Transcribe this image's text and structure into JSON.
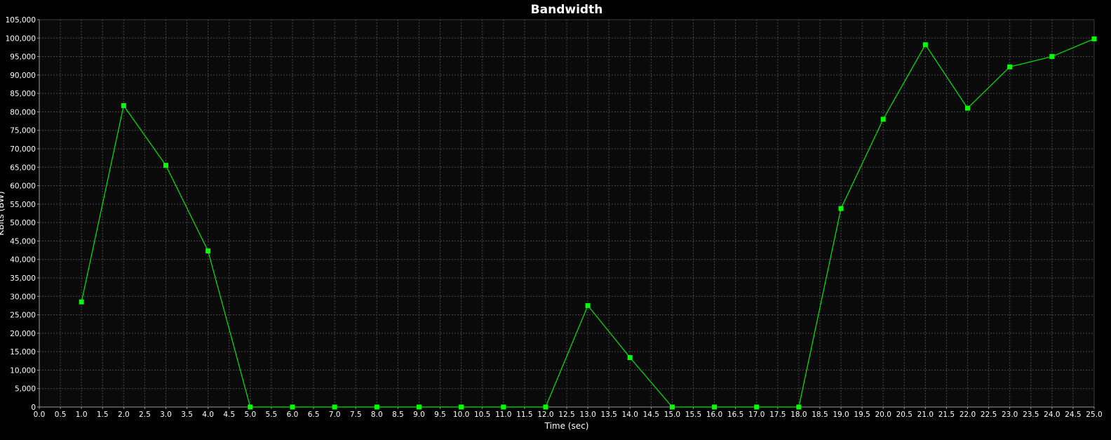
{
  "chart_data": {
    "type": "line",
    "title": "Bandwidth",
    "xlabel": "Time (sec)",
    "ylabel": "KBits (BW)",
    "xlim": [
      0,
      25
    ],
    "ylim": [
      0,
      105000
    ],
    "x_tick_step": 0.5,
    "y_tick_step": 5000,
    "grid": true,
    "legend": "none",
    "series": [
      {
        "x": [
          1,
          2,
          3,
          4,
          5,
          6,
          7,
          8,
          9,
          10,
          11,
          12,
          13,
          14,
          15,
          16,
          17,
          18,
          19,
          20,
          21,
          22,
          23,
          24,
          25
        ],
        "y": [
          28500,
          81700,
          65500,
          42300,
          0,
          0,
          0,
          0,
          0,
          0,
          0,
          0,
          27500,
          13400,
          0,
          0,
          0,
          0,
          53800,
          78000,
          98200,
          81000,
          92200,
          95000,
          99800
        ]
      }
    ],
    "colors": {
      "background": "#000000",
      "plot_background": "#0a0a0a",
      "grid": "#4a4a4a",
      "axis": "#9a9a9a",
      "text": "#ffffff",
      "line": "#00e600",
      "marker": "#00ff00"
    }
  }
}
